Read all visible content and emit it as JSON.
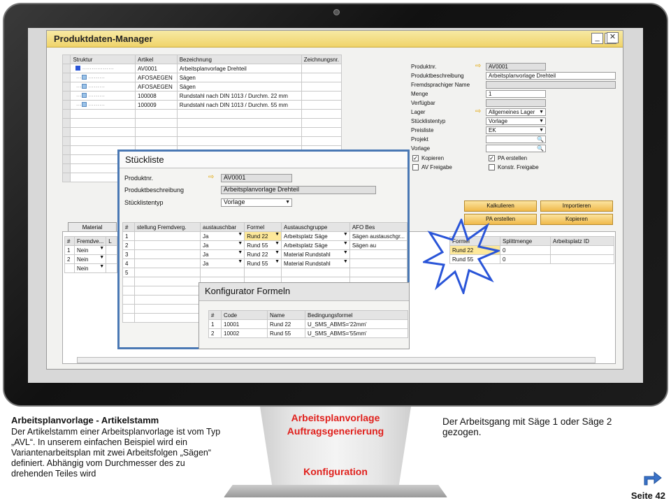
{
  "window": {
    "title": "Produktdaten-Manager"
  },
  "tree_grid": {
    "headers": [
      "Struktur",
      "Artikel",
      "Bezeichnung",
      "Zeichnungsnr."
    ],
    "rows": [
      [
        "",
        "AV0001",
        "Arbeitsplanvorlage  Drehteil",
        ""
      ],
      [
        "",
        "AFOSAEGEN",
        "Sägen",
        ""
      ],
      [
        "",
        "AFOSAEGEN",
        "Sägen",
        ""
      ],
      [
        "",
        "100008",
        "Rundstahl nach DIN 1013 / Durchm. 22 mm",
        ""
      ],
      [
        "",
        "100009",
        "Rundstahl nach DIN 1013 / Durchm. 55 mm",
        ""
      ]
    ]
  },
  "form": {
    "produktnr_label": "Produktnr.",
    "produktnr_value": "AV0001",
    "beschreibung_label": "Produktbeschreibung",
    "beschreibung_value": "Arbeitsplanvorlage  Drehteil",
    "fremdsprachig_label": "Fremdsprachiger Name",
    "menge_label": "Menge",
    "menge_value": "1",
    "verfuegbar_label": "Verfügbar",
    "lager_label": "Lager",
    "lager_value": "Allgemeines Lager",
    "stuecklistentyp_label": "Stücklistentyp",
    "stuecklistentyp_value": "Vorlage",
    "preisliste_label": "Preisliste",
    "preisliste_value": "EK",
    "projekt_label": "Projekt",
    "vorlage_label": "Vorlage",
    "kopieren_label": "Kopieren",
    "pa_erstellen_check_label": "PA erstellen",
    "av_freigabe_label": "AV Freigabe",
    "konstr_freigabe_label": "Konstr. Freigabe"
  },
  "buttons": {
    "kalkulieren": "Kalkulieren",
    "importieren": "Importieren",
    "pa_erstellen": "PA erstellen",
    "kopieren": "Kopieren"
  },
  "tabs": {
    "material": "Material"
  },
  "lower_grid": {
    "headers": [
      "#",
      "Fremdve...",
      "L"
    ],
    "rows": [
      [
        "1",
        "Nein"
      ],
      [
        "2",
        "Nein"
      ],
      [
        "",
        "Nein"
      ]
    ]
  },
  "right_grid": {
    "headers": [
      "Formel",
      "Splittmenge",
      "Arbeitsplatz ID"
    ],
    "rows": [
      [
        "Rund 22",
        "0"
      ],
      [
        "Rund 55",
        "0"
      ]
    ]
  },
  "stueckliste": {
    "title": "Stückliste",
    "produktnr_label": "Produktnr.",
    "produktnr_value": "AV0001",
    "beschreibung_label": "Produktbeschreibung",
    "beschreibung_value": "Arbeitsplanvorlage  Drehteil",
    "typ_label": "Stücklistentyp",
    "typ_value": "Vorlage",
    "headers": [
      "#",
      "stellung Fremdverg.",
      "austauschbar",
      "Formel",
      "Austauschgruppe",
      "AFO Bes"
    ],
    "rows": [
      [
        "1",
        "",
        "Ja",
        "Rund 22",
        "Arbeitsplatz Säge",
        "Sägen austauschgr..."
      ],
      [
        "2",
        "",
        "Ja",
        "Rund 55",
        "Arbeitsplatz Säge",
        "Sägen au"
      ],
      [
        "3",
        "",
        "Ja",
        "Rund 22",
        "Material Rundstahl",
        ""
      ],
      [
        "4",
        "",
        "Ja",
        "Rund 55",
        "Material Rundstahl",
        ""
      ],
      [
        "5",
        "",
        "",
        "",
        "",
        ""
      ]
    ]
  },
  "konfigurator": {
    "title": "Konfigurator Formeln",
    "headers": [
      "#",
      "Code",
      "Name",
      "Bedingungsformel"
    ],
    "rows": [
      [
        "1",
        "10001",
        "Rund 22",
        "U_SMS_ABMS='22mm'"
      ],
      [
        "2",
        "10002",
        "Rund 55",
        "U_SMS_ABMS='55mm'"
      ]
    ]
  },
  "slide": {
    "left_heading": "Arbeitsplanvorlage - Artikelstamm",
    "left_body": "Der Artikelstamm einer Arbeitsplanvorlage ist vom Typ „AVL“. In unserem einfachen Beispiel wird ein Variantenarbeitsplan mit zwei Arbeitsfolgen „Sägen“ definiert. Abhängig vom Durchmesser des zu drehenden Teiles wird",
    "center_line1": "Arbeitsplanvorlage",
    "center_line2": "Auftragsgenerierung",
    "center_line3": "Konfiguration",
    "right_body": "Der Arbeitsgang mit Säge 1 oder Säge 2 gezogen.",
    "page": "Seite 42"
  },
  "colors": {
    "accent_red": "#e0201c",
    "frame_blue": "#4a78b4",
    "sap_yellow": "#f0d46a",
    "star_blue": "#2a55d8"
  }
}
